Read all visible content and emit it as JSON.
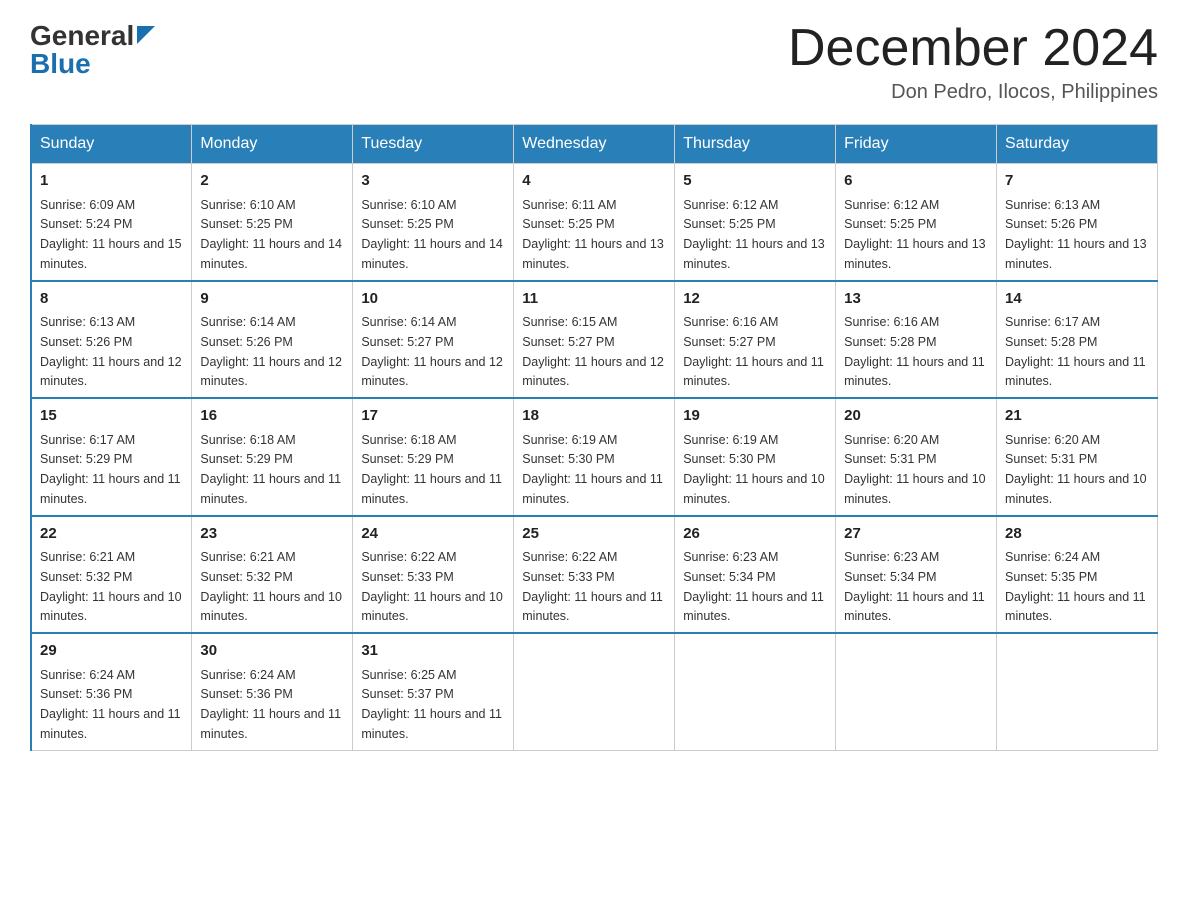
{
  "header": {
    "logo_general": "General",
    "logo_blue": "Blue",
    "month_title": "December 2024",
    "location": "Don Pedro, Ilocos, Philippines"
  },
  "days_of_week": [
    "Sunday",
    "Monday",
    "Tuesday",
    "Wednesday",
    "Thursday",
    "Friday",
    "Saturday"
  ],
  "weeks": [
    [
      {
        "day": "1",
        "sunrise": "6:09 AM",
        "sunset": "5:24 PM",
        "daylight": "11 hours and 15 minutes."
      },
      {
        "day": "2",
        "sunrise": "6:10 AM",
        "sunset": "5:25 PM",
        "daylight": "11 hours and 14 minutes."
      },
      {
        "day": "3",
        "sunrise": "6:10 AM",
        "sunset": "5:25 PM",
        "daylight": "11 hours and 14 minutes."
      },
      {
        "day": "4",
        "sunrise": "6:11 AM",
        "sunset": "5:25 PM",
        "daylight": "11 hours and 13 minutes."
      },
      {
        "day": "5",
        "sunrise": "6:12 AM",
        "sunset": "5:25 PM",
        "daylight": "11 hours and 13 minutes."
      },
      {
        "day": "6",
        "sunrise": "6:12 AM",
        "sunset": "5:25 PM",
        "daylight": "11 hours and 13 minutes."
      },
      {
        "day": "7",
        "sunrise": "6:13 AM",
        "sunset": "5:26 PM",
        "daylight": "11 hours and 13 minutes."
      }
    ],
    [
      {
        "day": "8",
        "sunrise": "6:13 AM",
        "sunset": "5:26 PM",
        "daylight": "11 hours and 12 minutes."
      },
      {
        "day": "9",
        "sunrise": "6:14 AM",
        "sunset": "5:26 PM",
        "daylight": "11 hours and 12 minutes."
      },
      {
        "day": "10",
        "sunrise": "6:14 AM",
        "sunset": "5:27 PM",
        "daylight": "11 hours and 12 minutes."
      },
      {
        "day": "11",
        "sunrise": "6:15 AM",
        "sunset": "5:27 PM",
        "daylight": "11 hours and 12 minutes."
      },
      {
        "day": "12",
        "sunrise": "6:16 AM",
        "sunset": "5:27 PM",
        "daylight": "11 hours and 11 minutes."
      },
      {
        "day": "13",
        "sunrise": "6:16 AM",
        "sunset": "5:28 PM",
        "daylight": "11 hours and 11 minutes."
      },
      {
        "day": "14",
        "sunrise": "6:17 AM",
        "sunset": "5:28 PM",
        "daylight": "11 hours and 11 minutes."
      }
    ],
    [
      {
        "day": "15",
        "sunrise": "6:17 AM",
        "sunset": "5:29 PM",
        "daylight": "11 hours and 11 minutes."
      },
      {
        "day": "16",
        "sunrise": "6:18 AM",
        "sunset": "5:29 PM",
        "daylight": "11 hours and 11 minutes."
      },
      {
        "day": "17",
        "sunrise": "6:18 AM",
        "sunset": "5:29 PM",
        "daylight": "11 hours and 11 minutes."
      },
      {
        "day": "18",
        "sunrise": "6:19 AM",
        "sunset": "5:30 PM",
        "daylight": "11 hours and 11 minutes."
      },
      {
        "day": "19",
        "sunrise": "6:19 AM",
        "sunset": "5:30 PM",
        "daylight": "11 hours and 10 minutes."
      },
      {
        "day": "20",
        "sunrise": "6:20 AM",
        "sunset": "5:31 PM",
        "daylight": "11 hours and 10 minutes."
      },
      {
        "day": "21",
        "sunrise": "6:20 AM",
        "sunset": "5:31 PM",
        "daylight": "11 hours and 10 minutes."
      }
    ],
    [
      {
        "day": "22",
        "sunrise": "6:21 AM",
        "sunset": "5:32 PM",
        "daylight": "11 hours and 10 minutes."
      },
      {
        "day": "23",
        "sunrise": "6:21 AM",
        "sunset": "5:32 PM",
        "daylight": "11 hours and 10 minutes."
      },
      {
        "day": "24",
        "sunrise": "6:22 AM",
        "sunset": "5:33 PM",
        "daylight": "11 hours and 10 minutes."
      },
      {
        "day": "25",
        "sunrise": "6:22 AM",
        "sunset": "5:33 PM",
        "daylight": "11 hours and 11 minutes."
      },
      {
        "day": "26",
        "sunrise": "6:23 AM",
        "sunset": "5:34 PM",
        "daylight": "11 hours and 11 minutes."
      },
      {
        "day": "27",
        "sunrise": "6:23 AM",
        "sunset": "5:34 PM",
        "daylight": "11 hours and 11 minutes."
      },
      {
        "day": "28",
        "sunrise": "6:24 AM",
        "sunset": "5:35 PM",
        "daylight": "11 hours and 11 minutes."
      }
    ],
    [
      {
        "day": "29",
        "sunrise": "6:24 AM",
        "sunset": "5:36 PM",
        "daylight": "11 hours and 11 minutes."
      },
      {
        "day": "30",
        "sunrise": "6:24 AM",
        "sunset": "5:36 PM",
        "daylight": "11 hours and 11 minutes."
      },
      {
        "day": "31",
        "sunrise": "6:25 AM",
        "sunset": "5:37 PM",
        "daylight": "11 hours and 11 minutes."
      },
      null,
      null,
      null,
      null
    ]
  ]
}
